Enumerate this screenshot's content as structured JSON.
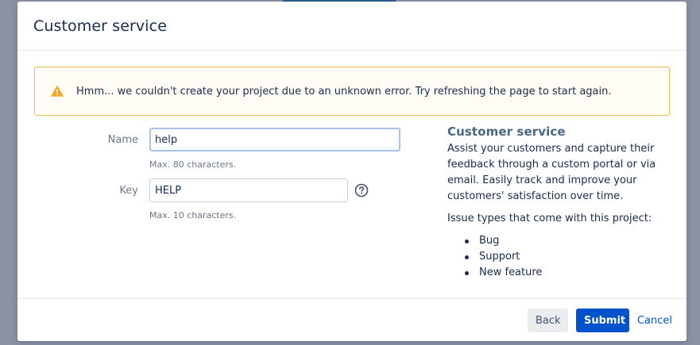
{
  "dialog": {
    "title": "Customer service"
  },
  "warning": {
    "icon": "warning-triangle-icon",
    "message": "Hmm... we couldn't create your project due to an unknown error. Try refreshing the page to start again."
  },
  "form": {
    "name": {
      "label": "Name",
      "value": "help",
      "hint": "Max. 80 characters."
    },
    "key": {
      "label": "Key",
      "value": "HELP",
      "hint": "Max. 10 characters.",
      "help_icon": "question-circle-icon"
    }
  },
  "sidebar": {
    "title": "Customer service",
    "description": "Assist your customers and capture their feedback through a custom portal or via email. Easily track and improve your customers' satisfaction over time.",
    "issue_types_heading": "Issue types that come with this project:",
    "issue_types": [
      "Bug",
      "Support",
      "New feature"
    ]
  },
  "footer": {
    "back_label": "Back",
    "submit_label": "Submit",
    "cancel_label": "Cancel"
  },
  "colors": {
    "primary": "#0052cc",
    "warning_border": "#e8b84a",
    "warning_icon": "#f5a623",
    "backdrop": "#8b93a3"
  }
}
